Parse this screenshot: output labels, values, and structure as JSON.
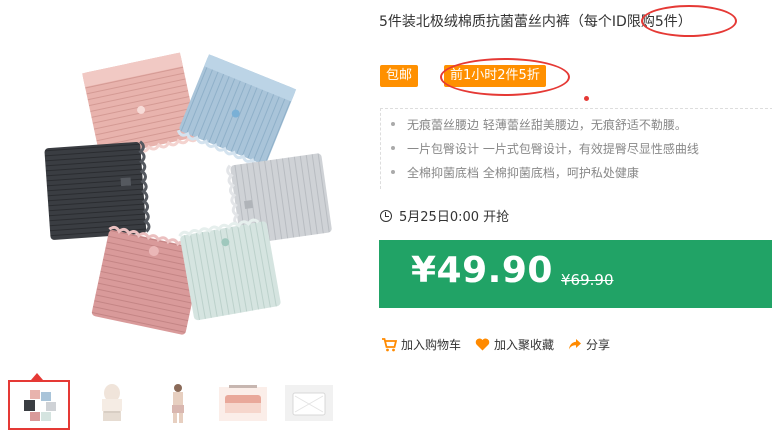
{
  "product": {
    "title": "5件装北极绒棉质抗菌蕾丝内裤（每个ID限购5件）"
  },
  "tags": {
    "baoyou": "包邮",
    "promo": "前1小时2件5折"
  },
  "features": [
    "无痕蕾丝腰边  轻薄蕾丝甜美腰边，无痕舒适不勒腰。",
    "一片包臀设计  一片式包臀设计，有效提臀尽显性感曲线",
    "全棉抑菌底档  全棉抑菌底档，呵护私处健康"
  ],
  "sale_time": "5月25日0:00 开抢",
  "price": {
    "current": "¥49.90",
    "original": "¥69.90"
  },
  "actions": {
    "cart": "加入购物车",
    "fav": "加入聚收藏",
    "share": "分享"
  },
  "colors": {
    "price_bg": "#21a366",
    "tag_bg": "#ff9000",
    "highlight": "#e53935"
  }
}
